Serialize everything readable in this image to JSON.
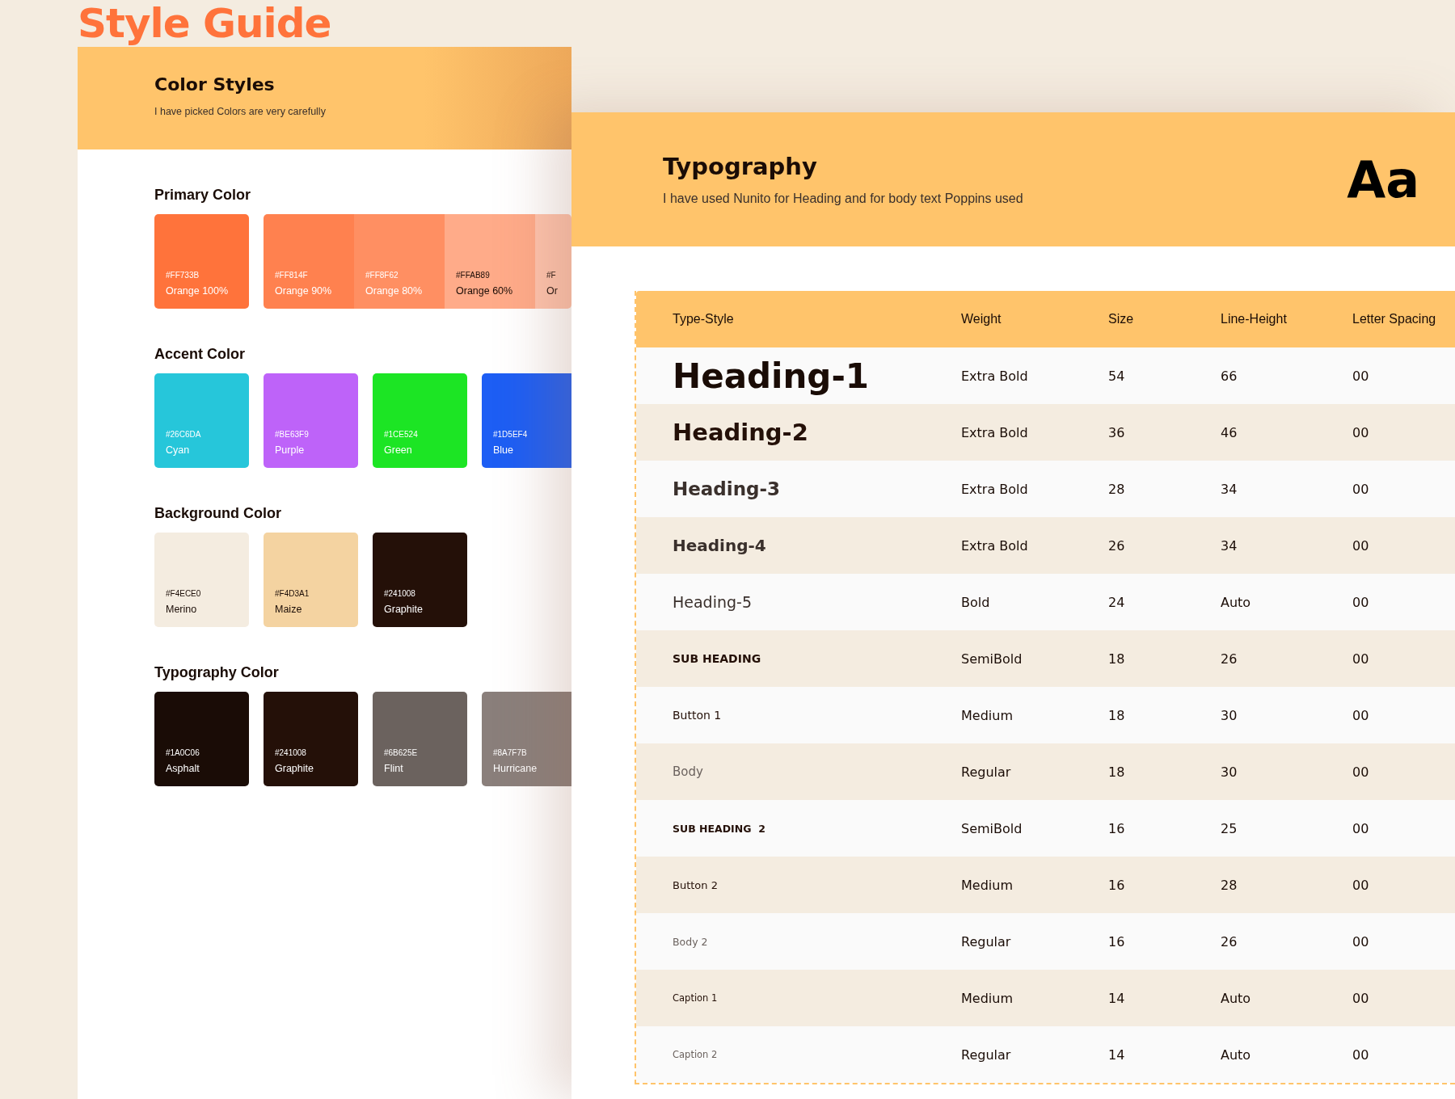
{
  "title": "Style Guide",
  "color_styles": {
    "title": "Color Styles",
    "subtitle": "I have picked Colors are very carefully",
    "groups": [
      {
        "label": "Primary Color",
        "kind": "split",
        "swatches": [
          {
            "hex": "#FF733B",
            "name": "Orange 100%",
            "color": "#ff733b"
          },
          {
            "hex": "#FF814F",
            "name": "Orange 90%",
            "color": "#ff814f"
          },
          {
            "hex": "#FF8F62",
            "name": "Orange 80%",
            "color": "#ff8f62"
          },
          {
            "hex": "#FFAB89",
            "name": "Orange 60%",
            "color": "#ffab89"
          },
          {
            "hex": "#F",
            "name": "Or",
            "color": "#ffc4ad"
          }
        ]
      },
      {
        "label": "Accent Color",
        "kind": "grid",
        "swatches": [
          {
            "hex": "#26C6DA",
            "name": "Cyan",
            "color": "#26c6da"
          },
          {
            "hex": "#BE63F9",
            "name": "Purple",
            "color": "#be63f9"
          },
          {
            "hex": "#1CE524",
            "name": "Green",
            "color": "#1ce524"
          },
          {
            "hex": "#1D5EF4",
            "name": "Blue",
            "color": "#1d5ef4"
          }
        ]
      },
      {
        "label": "Background Color",
        "kind": "grid",
        "swatches": [
          {
            "hex": "#F4ECE0",
            "name": "Merino",
            "color": "#f4ece0"
          },
          {
            "hex": "#F4D3A1",
            "name": "Maize",
            "color": "#f4d3a1"
          },
          {
            "hex": "#241008",
            "name": "Graphite",
            "color": "#241008"
          }
        ]
      },
      {
        "label": "Typography Color",
        "kind": "grid",
        "swatches": [
          {
            "hex": "#1A0C06",
            "name": "Asphalt",
            "color": "#1a0c06"
          },
          {
            "hex": "#241008",
            "name": "Graphite",
            "color": "#241008"
          },
          {
            "hex": "#6B625E",
            "name": "Flint",
            "color": "#6b625e"
          },
          {
            "hex": "#8A7F7B",
            "name": "Hurricane",
            "color": "#8a7f7b"
          }
        ]
      }
    ]
  },
  "typography": {
    "title": "Typography",
    "subtitle": "I have used Nunito for Heading and for body text Poppins used",
    "sample": "Aa",
    "table": {
      "columns": [
        "Type-Style",
        "Weight",
        "Size",
        "Line-Height",
        "Letter Spacing"
      ],
      "rows": [
        {
          "kind": "h1",
          "cells": [
            "Heading-1",
            "Extra Bold",
            "54",
            "66",
            "00"
          ]
        },
        {
          "kind": "h2",
          "cells": [
            "Heading-2",
            "Extra Bold",
            "36",
            "46",
            "00"
          ]
        },
        {
          "kind": "h3",
          "cells": [
            "Heading-3",
            "Extra Bold",
            "28",
            "34",
            "00"
          ]
        },
        {
          "kind": "h4",
          "cells": [
            "Heading-4",
            "Extra Bold",
            "26",
            "34",
            "00"
          ]
        },
        {
          "kind": "h5",
          "cells": [
            "Heading-5",
            "Bold",
            "24",
            "Auto",
            "00"
          ]
        },
        {
          "kind": "sub",
          "cells": [
            "SUB HEADING",
            "SemiBold",
            "18",
            "26",
            "00"
          ]
        },
        {
          "kind": "button",
          "cells": [
            "Button 1",
            "Medium",
            "18",
            "30",
            "00"
          ]
        },
        {
          "kind": "body",
          "cells": [
            "Body",
            "Regular",
            "18",
            "30",
            "00"
          ]
        },
        {
          "kind": "sub2",
          "cells": [
            "SUB HEADING  2",
            "SemiBold",
            "16",
            "25",
            "00"
          ]
        },
        {
          "kind": "button2",
          "cells": [
            "Button 2",
            "Medium",
            "16",
            "28",
            "00"
          ]
        },
        {
          "kind": "body2",
          "cells": [
            "Body 2",
            "Regular",
            "16",
            "26",
            "00"
          ]
        },
        {
          "kind": "caption",
          "cells": [
            "Caption 1",
            "Medium",
            "14",
            "Auto",
            "00"
          ]
        },
        {
          "kind": "caption2",
          "cells": [
            "Caption 2",
            "Regular",
            "14",
            "Auto",
            "00"
          ]
        }
      ]
    }
  }
}
